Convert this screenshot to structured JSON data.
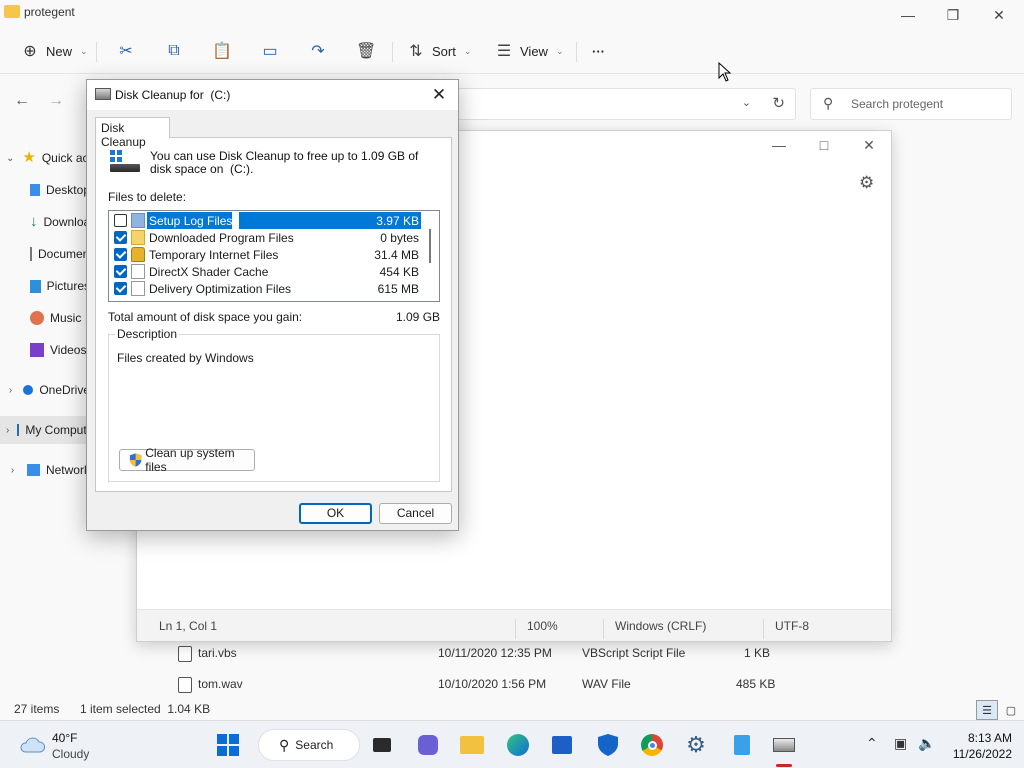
{
  "explorer": {
    "title": "protegent",
    "toolbar": {
      "new_label": "New",
      "sort_label": "Sort",
      "view_label": "View",
      "more_label": "···"
    },
    "search_placeholder": "Search protegent",
    "nav": [
      {
        "label": "Quick access",
        "icon": "star-icon"
      },
      {
        "label": "Desktop",
        "icon": "desktop-icon"
      },
      {
        "label": "Downloads",
        "icon": "download-icon"
      },
      {
        "label": "Documents",
        "icon": "document-icon"
      },
      {
        "label": "Pictures",
        "icon": "picture-icon"
      },
      {
        "label": "Music",
        "icon": "music-icon"
      },
      {
        "label": "Videos",
        "icon": "video-icon"
      },
      {
        "label": "OneDrive",
        "icon": "cloud-icon"
      },
      {
        "label": "My Computer",
        "icon": "monitor-icon"
      },
      {
        "label": "Network",
        "icon": "network-icon"
      }
    ],
    "files": [
      {
        "name": "tari.vbs",
        "date": "10/11/2020 12:35 PM",
        "type": "VBScript Script File",
        "size": "1 KB"
      },
      {
        "name": "tom.wav",
        "date": "10/10/2020 1:56 PM",
        "type": "WAV File",
        "size": "485 KB"
      }
    ],
    "status": {
      "items": "27 items",
      "selected": "1 item selected  1.04 KB"
    }
  },
  "notepad": {
    "status": {
      "position": "Ln 1, Col 1",
      "zoom": "100%",
      "line_ending": "Windows (CRLF)",
      "encoding": "UTF-8"
    }
  },
  "dialog": {
    "title": "Disk Cleanup for  (C:)",
    "tab": "Disk Cleanup",
    "intro": "You can use Disk Cleanup to free up to 1.09 GB of disk space on  (C:).",
    "files_label": "Files to delete:",
    "files": [
      {
        "name": "Setup Log Files",
        "size": "3.97 KB",
        "checked": false
      },
      {
        "name": "Downloaded Program Files",
        "size": "0 bytes",
        "checked": true
      },
      {
        "name": "Temporary Internet Files",
        "size": "31.4 MB",
        "checked": true
      },
      {
        "name": "DirectX Shader Cache",
        "size": "454 KB",
        "checked": true
      },
      {
        "name": "Delivery Optimization Files",
        "size": "615 MB",
        "checked": true
      }
    ],
    "total_label": "Total amount of disk space you gain:",
    "total_value": "1.09 GB",
    "description_legend": "Description",
    "description_text": "Files created by Windows",
    "cleanup_system_label": "Clean up system files",
    "ok_label": "OK",
    "cancel_label": "Cancel"
  },
  "taskbar": {
    "weather_temp": "40°F",
    "weather_cond": "Cloudy",
    "search_label": "Search",
    "time": "8:13 AM",
    "date": "11/26/2022"
  }
}
